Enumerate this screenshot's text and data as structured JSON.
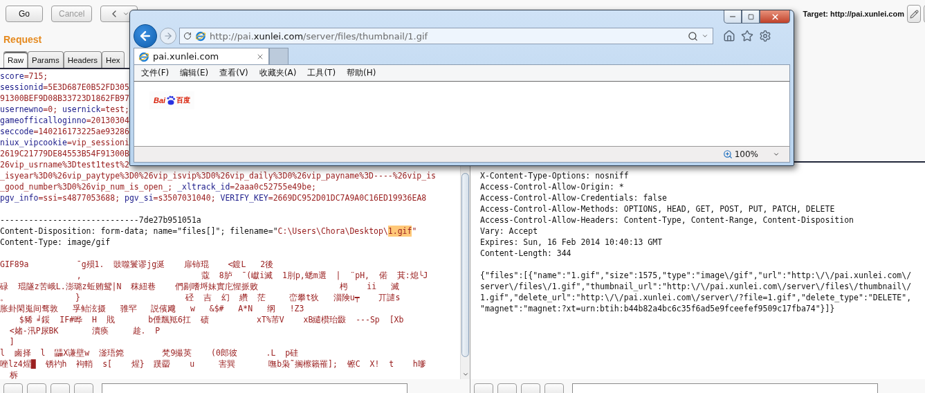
{
  "toolbar": {
    "buttons": [
      {
        "label": "Go",
        "disabled": false
      },
      {
        "label": "Cancel",
        "disabled": true
      }
    ],
    "target": "Target: http://pai.xunlei.com"
  },
  "request": {
    "title": "Request",
    "tabs": [
      {
        "label": "Raw",
        "selected": true
      },
      {
        "label": "Params",
        "selected": false
      },
      {
        "label": "Headers",
        "selected": false
      },
      {
        "label": "Hex",
        "selected": false
      }
    ],
    "lines": [
      {
        "kind": "code",
        "segments": [
          {
            "text": "score",
            "kind": "name"
          },
          {
            "text": "=715;",
            "kind": "value"
          }
        ]
      },
      {
        "kind": "code",
        "segments": [
          {
            "text": "sessionid",
            "kind": "name"
          },
          {
            "text": "=5E3D687E0B52FD305",
            "kind": "value"
          }
        ]
      },
      {
        "kind": "code",
        "segments": [
          {
            "text": "91300BEF9D08B33723D1862FB97",
            "kind": "value"
          }
        ]
      },
      {
        "kind": "code",
        "segments": [
          {
            "text": "usernewno",
            "kind": "name"
          },
          {
            "text": "=0; ",
            "kind": "value"
          },
          {
            "text": "usernick",
            "kind": "name"
          },
          {
            "text": "=test;",
            "kind": "value"
          }
        ]
      },
      {
        "kind": "code",
        "segments": [
          {
            "text": "gameofficalloginno",
            "kind": "name"
          },
          {
            "text": "=20130304",
            "kind": "value"
          }
        ]
      },
      {
        "kind": "code",
        "segments": [
          {
            "text": "seccode",
            "kind": "name"
          },
          {
            "text": "=140216173225ae93286",
            "kind": "value"
          }
        ]
      },
      {
        "kind": "code",
        "segments": [
          {
            "text": "niux_vipcookie",
            "kind": "name"
          },
          {
            "text": "=vip_sessioni",
            "kind": "value"
          }
        ]
      },
      {
        "kind": "code",
        "segments": [
          {
            "text": "2619C21779DE84553B54F91300B",
            "kind": "value"
          }
        ]
      },
      {
        "kind": "code",
        "segments": [
          {
            "text": "26vip_usrname%3Dtest1test%2",
            "kind": "value"
          }
        ]
      },
      {
        "kind": "code",
        "segments": [
          {
            "text": "_isyear%3D0%26vip_paytype%3D0%26vip_isvip%3D0%26vip_daily%3D0%26vip_payname%3D----%26vip_is",
            "kind": "value"
          }
        ]
      },
      {
        "kind": "code",
        "segments": [
          {
            "text": "_good_number%3D0%26vip_num_is_open_; ",
            "kind": "value"
          },
          {
            "text": "_xltrack_id",
            "kind": "name"
          },
          {
            "text": "=2aaa0c52755e49be;",
            "kind": "value"
          }
        ]
      },
      {
        "kind": "code",
        "segments": [
          {
            "text": "pgv_info",
            "kind": "name"
          },
          {
            "text": "=ssi=s4877053688; ",
            "kind": "value"
          },
          {
            "text": "pgv_si",
            "kind": "name"
          },
          {
            "text": "=s3507031040; ",
            "kind": "value"
          },
          {
            "text": "VERIFY_KEY",
            "kind": "name"
          },
          {
            "text": "=2669DC952D01DC7A9A0C16ED19936EA8",
            "kind": "value"
          }
        ]
      },
      {
        "kind": "blank"
      },
      {
        "kind": "code",
        "segments": [
          {
            "text": "-----------------------------7de27b951051a",
            "kind": "plain"
          }
        ]
      },
      {
        "kind": "code",
        "segments": [
          {
            "text": "Content-Disposition: form-data; name=\"files[]\"; filename=\"",
            "kind": "plain"
          },
          {
            "text": "C:\\Users\\Chora\\Desktop\\",
            "kind": "value"
          },
          {
            "text": "1.gif",
            "kind": "match"
          },
          {
            "text": "\"",
            "kind": "value"
          }
        ]
      },
      {
        "kind": "code",
        "segments": [
          {
            "text": "Content-Type: image/gif",
            "kind": "plain"
          }
        ]
      },
      {
        "kind": "blank"
      },
      {
        "kind": "code",
        "segments": [
          {
            "text": "GIF89a          ˉg殒1.  豉噬鬟谬jg涎    扉铈琨    <鍍L   2後",
            "kind": "value"
          }
        ]
      },
      {
        "kind": "code",
        "segments": [
          {
            "text": "                ,                         蔻  8胪  ˉ(巘i滅  1刖p,蟋m選  |  ¨pH,  偌  萁:熄╰J",
            "kind": "value"
          }
        ]
      },
      {
        "kind": "code",
        "segments": [
          {
            "text": "碌  琨隧z苦峨L.澎璐z蚯贿鸳|N  秣紐巷    們剔嗜埒妹實庀惺挀败                 枵    ii   滅",
            "kind": "value"
          }
        ]
      },
      {
        "kind": "code",
        "segments": [
          {
            "text": "。              }                      硁  吉  幻  纘  茫     峦攀t狄   淄険u┯    丌譴s",
            "kind": "value"
          }
        ]
      },
      {
        "kind": "code",
        "segments": [
          {
            "text": "胀卦閑嵬间骛敦   孚鲐泫摄   骓罕   説儐飕   w   &$#   A*N   纲   !Z3",
            "kind": "value"
          }
        ]
      },
      {
        "kind": "code",
        "segments": [
          {
            "text": "    $豨 ╛鋖  IF#晔  H  戝       b倕飄羝6扛  碛          xT%芾V    xB繾欑珆敠  ---Sp  [Xb",
            "kind": "value"
          }
        ]
      },
      {
        "kind": "code",
        "segments": [
          {
            "text": "  <媎-汛P尿BK       瀆痪     趁.  P",
            "kind": "value"
          }
        ]
      },
      {
        "kind": "code",
        "segments": [
          {
            "text": "  ]",
            "kind": "value"
          }
        ]
      },
      {
        "kind": "code",
        "segments": [
          {
            "text": "l  鹵择  l  鼺X谦壁w  滏珸箢        梵9撮英    (0郎彼      .L  p硅",
            "kind": "value"
          }
        ]
      },
      {
        "kind": "code",
        "segments": [
          {
            "text": "唑lz4煋█  锈礿h  袧輎  s[    煋}  蹼罶    u     害巽       嘸b枭˜搁檫籟罹];  镲C  X!  t    h嗲",
            "kind": "value"
          }
        ]
      },
      {
        "kind": "code",
        "segments": [
          {
            "text": "  柝",
            "kind": "value"
          }
        ]
      }
    ]
  },
  "response": {
    "lines": [
      {
        "kind": "text",
        "text": "X-Content-Type-Options: nosniff"
      },
      {
        "kind": "text",
        "text": "Access-Control-Allow-Origin: *"
      },
      {
        "kind": "text",
        "text": "Access-Control-Allow-Credentials: false"
      },
      {
        "kind": "text",
        "text": "Access-Control-Allow-Methods: OPTIONS, HEAD, GET, POST, PUT, PATCH, DELETE"
      },
      {
        "kind": "text",
        "text": "Access-Control-Allow-Headers: Content-Type, Content-Range, Content-Disposition"
      },
      {
        "kind": "text",
        "text": "Vary: Accept"
      },
      {
        "kind": "text",
        "text": "Expires: Sun, 16 Feb 2014 10:40:13 GMT"
      },
      {
        "kind": "text",
        "text": "Content-Length: 344"
      },
      {
        "kind": "blank"
      },
      {
        "kind": "text",
        "text": "{\"files\":[{\"name\":\"1.gif\",\"size\":1575,\"type\":\"image\\/gif\",\"url\":\"http:\\/\\/pai.xunlei.com\\/"
      },
      {
        "kind": "text",
        "text": "server\\/files\\/1.gif\",\"thumbnail_url\":\"http:\\/\\/pai.xunlei.com\\/server\\/files\\/thumbnail\\/"
      },
      {
        "kind": "text",
        "text": "1.gif\",\"delete_url\":\"http:\\/\\/pai.xunlei.com\\/server\\/?file=1.gif\",\"delete_type\":\"DELETE\","
      },
      {
        "kind": "text",
        "text": "\"magnet\":\"magnet:?xt=urn:btih:b44b82a4bc6c35f6ad5e9fceefef9509c17fba74\"}]}"
      }
    ]
  },
  "browser": {
    "url": "http://pai.**xunlei.com**/server/files/thumbnail/1.gif",
    "tab": "pai.xunlei.com",
    "menu": [
      "文件(F)",
      "编辑(E)",
      "查看(V)",
      "收藏夹(A)",
      "工具(T)",
      "帮助(H)"
    ],
    "logo": {
      "latin": "Bai",
      "chinese": "百度"
    },
    "zoom": "100%"
  }
}
